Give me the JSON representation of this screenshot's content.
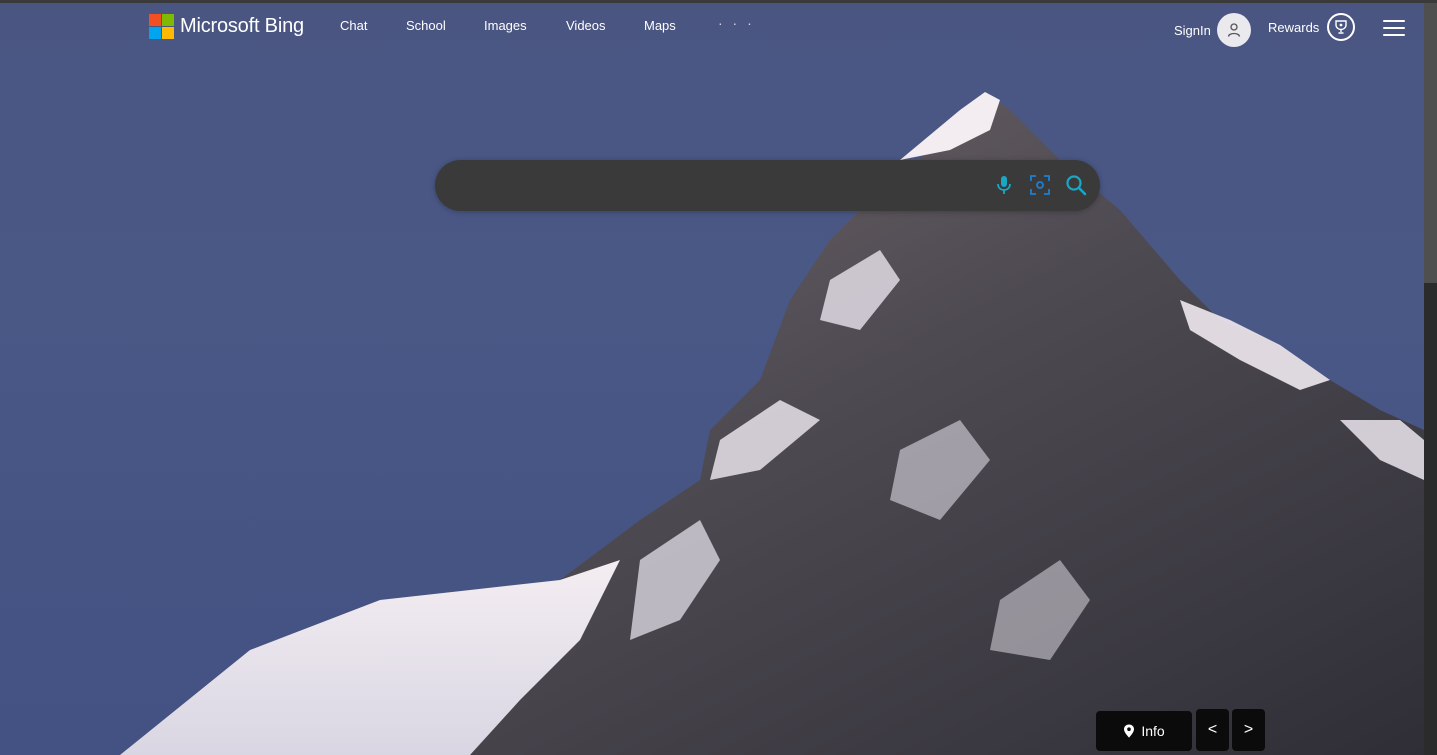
{
  "brand": {
    "name": "Microsoft Bing",
    "colors": [
      "#f25022",
      "#7fba00",
      "#00a4ef",
      "#ffb900"
    ]
  },
  "nav": {
    "items": [
      {
        "label": "Chat"
      },
      {
        "label": "School"
      },
      {
        "label": "Images"
      },
      {
        "label": "Videos"
      },
      {
        "label": "Maps"
      }
    ],
    "more": "· · ·"
  },
  "account": {
    "signin_label": "SignIn",
    "rewards_label": "Rewards"
  },
  "search": {
    "value": "",
    "placeholder": "",
    "icons": [
      "microphone-icon",
      "visual-search-icon",
      "search-icon"
    ],
    "accent": "#1aa7c4"
  },
  "footer": {
    "info_label": "Info",
    "prev": "<",
    "next": ">"
  },
  "background": {
    "subject": "mountain-peak-snow",
    "sky_color": "#4a5684"
  }
}
